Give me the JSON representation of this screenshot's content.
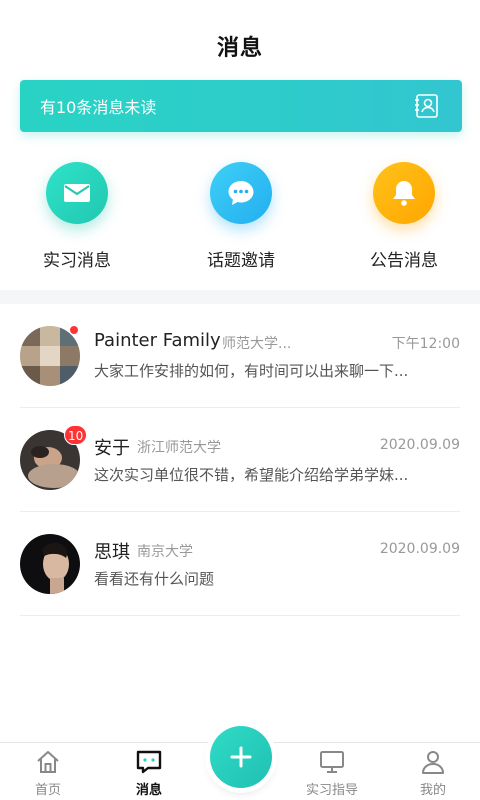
{
  "header": {
    "title": "消息"
  },
  "banner": {
    "text": "有10条消息未读",
    "icon": "contacts-icon"
  },
  "categories": [
    {
      "label": "实习消息",
      "icon": "envelope-icon",
      "color": "#22c7b0"
    },
    {
      "label": "话题邀请",
      "icon": "chat-bubble-icon",
      "color": "#24aef0"
    },
    {
      "label": "公告消息",
      "icon": "bell-icon",
      "color": "#ffa600"
    }
  ],
  "messages": [
    {
      "name": "Painter Family",
      "school": "师范大学...",
      "time": "下午12:00",
      "preview": "大家工作安排的如何，有时间可以出来聊一下...",
      "unread_dot": true
    },
    {
      "name": "安于",
      "school": "浙江师范大学",
      "time": "2020.09.09",
      "preview": "这次实习单位很不错，希望能介绍给学弟学妹...",
      "badge": "10"
    },
    {
      "name": "思琪",
      "school": "南京大学",
      "time": "2020.09.09",
      "preview": "看看还有什么问题"
    }
  ],
  "tabbar": {
    "items": [
      {
        "label": "首页",
        "icon": "home-icon"
      },
      {
        "label": "消息",
        "icon": "message-icon",
        "active": true
      },
      {
        "label": "实习指导",
        "icon": "monitor-icon"
      },
      {
        "label": "我的",
        "icon": "user-icon"
      }
    ],
    "fab_icon": "plus-icon"
  },
  "colors": {
    "accent": "#29d3c4",
    "badge": "#ff3333"
  }
}
